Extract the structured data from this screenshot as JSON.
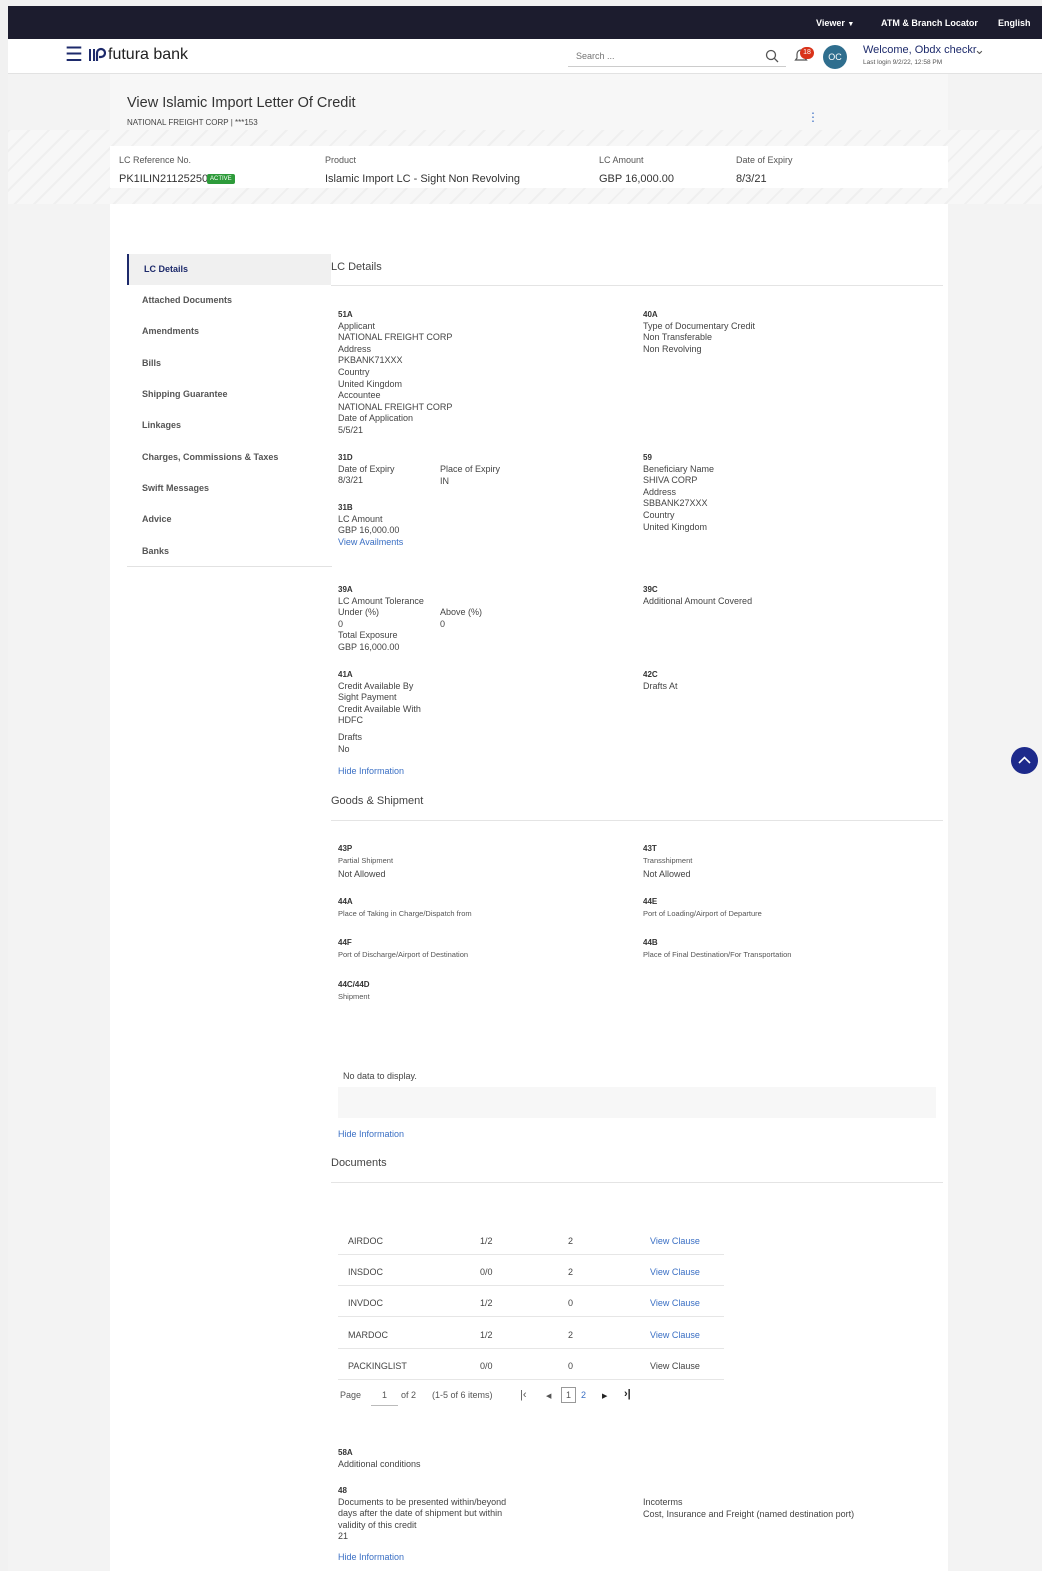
{
  "topbar": {
    "viewer": "Viewer",
    "locator": "ATM & Branch Locator",
    "language": "English"
  },
  "header": {
    "brand": "futura bank",
    "search_placeholder": "Search ...",
    "notification_count": "18",
    "avatar": "OC",
    "welcome": "Welcome, Obdx checkr",
    "last_login": "Last login 9/2/22, 12:58 PM"
  },
  "page": {
    "title": "View Islamic Import Letter Of Credit",
    "subtitle": "NATIONAL FREIGHT CORP | ***153"
  },
  "summary": {
    "ref_label": "LC Reference No.",
    "ref_value": "PK1ILIN211252502",
    "status": "ACTIVE",
    "product_label": "Product",
    "product_value": "Islamic Import LC - Sight Non Revolving",
    "amount_label": "LC Amount",
    "amount_value": "GBP 16,000.00",
    "expiry_label": "Date of Expiry",
    "expiry_value": "8/3/21"
  },
  "nav": [
    "LC Details",
    "Attached Documents",
    "Amendments",
    "Bills",
    "Shipping Guarantee",
    "Linkages",
    "Charges, Commissions & Taxes",
    "Swift Messages",
    "Advice",
    "Banks"
  ],
  "lc": {
    "section": "LC Details",
    "f51a": {
      "code": "51A",
      "l1": "Applicant",
      "v1": "NATIONAL FREIGHT CORP",
      "l2": "Address",
      "v2": "PKBANK71XXX",
      "l3": "Country",
      "v3": "United Kingdom",
      "l4": "Accountee",
      "v4": "NATIONAL FREIGHT CORP",
      "l5": "Date of Application",
      "v5": "5/5/21"
    },
    "f40a": {
      "code": "40A",
      "l1": "Type of Documentary Credit",
      "v1": "Non Transferable",
      "v2": "Non Revolving"
    },
    "f31d": {
      "code": "31D",
      "l1": "Date of Expiry",
      "v1": "8/3/21",
      "l2": "Place of Expiry",
      "v2": "IN"
    },
    "f59": {
      "code": "59",
      "l1": "Beneficiary Name",
      "v1": "SHIVA CORP",
      "l2": "Address",
      "v2": "SBBANK27XXX",
      "l3": "Country",
      "v3": "United Kingdom"
    },
    "f31b": {
      "code": "31B",
      "l1": "LC Amount",
      "v1": "GBP 16,000.00",
      "link": "View Availments"
    },
    "f39a": {
      "code": "39A",
      "l1": "LC Amount Tolerance",
      "l2": "Under (%)",
      "v2": "0",
      "l3": "Above (%)",
      "v3": "0",
      "l4": "Total Exposure",
      "v4": "GBP 16,000.00"
    },
    "f39c": {
      "code": "39C",
      "l1": "Additional Amount Covered"
    },
    "f41a": {
      "code": "41A",
      "l1": "Credit Available By",
      "v1": "Sight Payment",
      "l2": "Credit Available With",
      "v2": "HDFC",
      "l3": "Drafts",
      "v3": "No"
    },
    "f42c": {
      "code": "42C",
      "l1": "Drafts At"
    },
    "hide": "Hide Information"
  },
  "goods": {
    "section": "Goods & Shipment",
    "f43p": {
      "code": "43P",
      "label": "Partial Shipment",
      "value": "Not Allowed"
    },
    "f43t": {
      "code": "43T",
      "label": "Transshipment",
      "value": "Not Allowed"
    },
    "f44a": {
      "code": "44A",
      "label": "Place of Taking in Charge/Dispatch from"
    },
    "f44e": {
      "code": "44E",
      "label": "Port of Loading/Airport of Departure"
    },
    "f44f": {
      "code": "44F",
      "label": "Port of Discharge/Airport of Destination"
    },
    "f44b": {
      "code": "44B",
      "label": "Place of Final Destination/For Transportation"
    },
    "f44c": {
      "code": "44C/44D",
      "label": "Shipment"
    },
    "nodata": "No data to display.",
    "hide": "Hide Information"
  },
  "documents": {
    "section": "Documents",
    "rows": [
      {
        "name": "AIRDOC",
        "copies": "1/2",
        "count": "2",
        "action": "View Clause"
      },
      {
        "name": "INSDOC",
        "copies": "0/0",
        "count": "2",
        "action": "View Clause"
      },
      {
        "name": "INVDOC",
        "copies": "1/2",
        "count": "0",
        "action": "View Clause"
      },
      {
        "name": "MARDOC",
        "copies": "1/2",
        "count": "2",
        "action": "View Clause"
      },
      {
        "name": "PACKINGLIST",
        "copies": "0/0",
        "count": "0",
        "action": "View Clause"
      }
    ],
    "pager": {
      "page_label": "Page",
      "page": "1",
      "of": "of 2",
      "items": "(1-5 of 6 items)",
      "p1": "1",
      "p2": "2"
    }
  },
  "extra": {
    "f58a": {
      "code": "58A",
      "label": "Additional conditions"
    },
    "f48": {
      "code": "48",
      "l1": "Documents to be presented within/beyond",
      "l2": "days after the date of shipment but within",
      "l3": "validity of this credit",
      "value": "21"
    },
    "inco": {
      "label": "Incoterms",
      "value": "Cost, Insurance and Freight (named destination port)"
    },
    "hide": "Hide Information"
  }
}
